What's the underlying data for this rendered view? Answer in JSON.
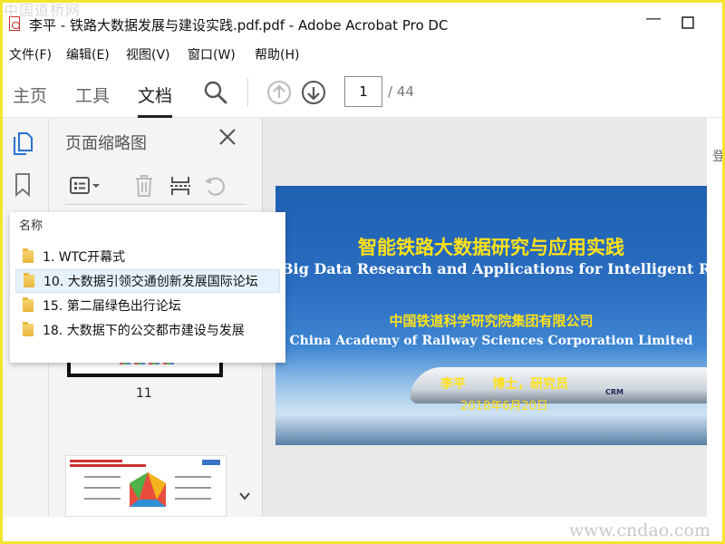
{
  "watermarks": {
    "top": "中国道桥网",
    "bottom": "www.cndao.com"
  },
  "window": {
    "title": "李平 - 铁路大数据发展与建设实践.pdf.pdf - Adobe Acrobat Pro DC"
  },
  "menu": [
    "文件(F)",
    "编辑(E)",
    "视图(V)",
    "窗口(W)",
    "帮助(H)"
  ],
  "toolbar": {
    "tabs": [
      "主页",
      "工具",
      "文档"
    ],
    "active_tab": "文档",
    "page_current": "1",
    "page_total": "/ 44",
    "cutoff_text": "登"
  },
  "panel": {
    "title": "页面缩略图",
    "thumb_label": "11"
  },
  "popup": {
    "header": "名称",
    "items": [
      "1. WTC开幕式",
      "10. 大数据引领交通创新发展国际论坛",
      "15. 第二届绿色出行论坛",
      "18. 大数据下的公交都市建设与发展"
    ],
    "selected_index": 1
  },
  "slide": {
    "title_cn": "智能铁路大数据研究与应用实践",
    "title_en": "Big Data Research and Applications for Intelligent Railway",
    "org_cn": "中国铁道科学研究院集团有限公司",
    "org_en": "China Academy of Railway Sciences Corporation Limited",
    "author": "李平      博士，研究员",
    "date": "2018年6月20日",
    "badge": "CRM"
  },
  "colors": {
    "slide_blue": "#1e5fb0",
    "slide_yellow": "#ffe11a",
    "selection": "#e5f1fb",
    "frame": "#f5e52a"
  }
}
